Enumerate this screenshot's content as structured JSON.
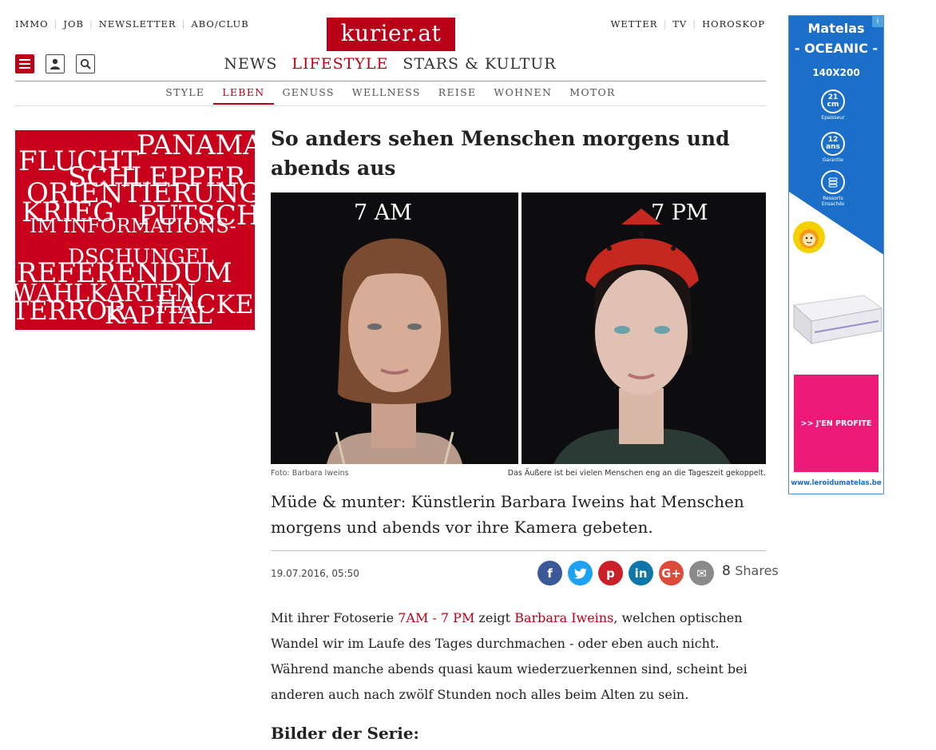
{
  "utility_nav": {
    "left": [
      "IMMO",
      "JOB",
      "NEWSLETTER",
      "ABO/CLUB"
    ],
    "right": [
      "WETTER",
      "TV",
      "HOROSKOP"
    ]
  },
  "logo": "kurier.at",
  "main_nav": [
    "NEWS",
    "LIFESTYLE",
    "STARS & KULTUR"
  ],
  "sub_nav": [
    "STYLE",
    "LEBEN",
    "GENUSS",
    "WELLNESS",
    "REISE",
    "WOHNEN",
    "MOTOR"
  ],
  "tag_cloud": [
    "PANAMA",
    "FLUCHT",
    "SCHLEPPER",
    "ORIENTIERUNG",
    "KRIEG",
    "PUTSCH",
    "IM INFORMATIONS-",
    "DSCHUNGEL",
    "REFERENDUM",
    "WAHLKARTEN",
    "HACKER",
    "TERROR",
    "KAPITAL"
  ],
  "article": {
    "headline": "So anders sehen Menschen morgens und abends aus",
    "photo_left_label": "7 AM",
    "photo_right_label": "7 PM",
    "photo_credit": "Foto: Barbara Iweins",
    "photo_caption": "Das Äußere ist bei vielen Menschen eng an die Tageszeit gekoppelt.",
    "lead": "Müde & munter: Künstlerin Barbara Iweins hat Menschen morgens und abends vor ihre Kamera gebeten.",
    "date": "19.07.2016, 05:50",
    "share_count": "8",
    "share_label": "Shares",
    "body_p1": "Mit ihrer Fotoserie ",
    "body_link1": "7AM - 7 PM",
    "body_p2": " zeigt ",
    "body_link2": "Barbara Iweins",
    "body_p3": ", welchen optischen Wandel wir im Laufe des Tages durchmachen - oder eben auch nicht. Während manche abends quasi kaum wiederzuerkennen sind, scheint bei anderen auch nach zwölf Stunden noch alles beim Alten zu sein.",
    "subhead": "Bilder der Serie:"
  },
  "share_buttons": [
    {
      "name": "facebook",
      "glyph": "f",
      "color": "#3b5998"
    },
    {
      "name": "twitter",
      "glyph": "t",
      "color": "#1da1f2"
    },
    {
      "name": "pinterest",
      "glyph": "p",
      "color": "#cb2027"
    },
    {
      "name": "linkedin",
      "glyph": "in",
      "color": "#0e76a8"
    },
    {
      "name": "googleplus",
      "glyph": "G+",
      "color": "#dd4b39"
    },
    {
      "name": "email",
      "glyph": "✉",
      "color": "#8a8a8a"
    }
  ],
  "ad": {
    "brand": "Matelas",
    "model": "- OCEANIC -",
    "size": "140X200",
    "features": [
      {
        "value": "21",
        "unit": "cm",
        "label": "Epaisseur"
      },
      {
        "value": "12",
        "unit": "ans",
        "label": "Garantie"
      },
      {
        "value": "",
        "unit": "",
        "label": "Ressorts Ensachés"
      }
    ],
    "cta": ">> J'EN PROFITE",
    "url": "www.leroidumatelas.be",
    "badge": "i"
  },
  "colors": {
    "brand_red": "#b90016",
    "ad_blue": "#1c6fc9",
    "ad_pink": "#ee1a7a"
  }
}
